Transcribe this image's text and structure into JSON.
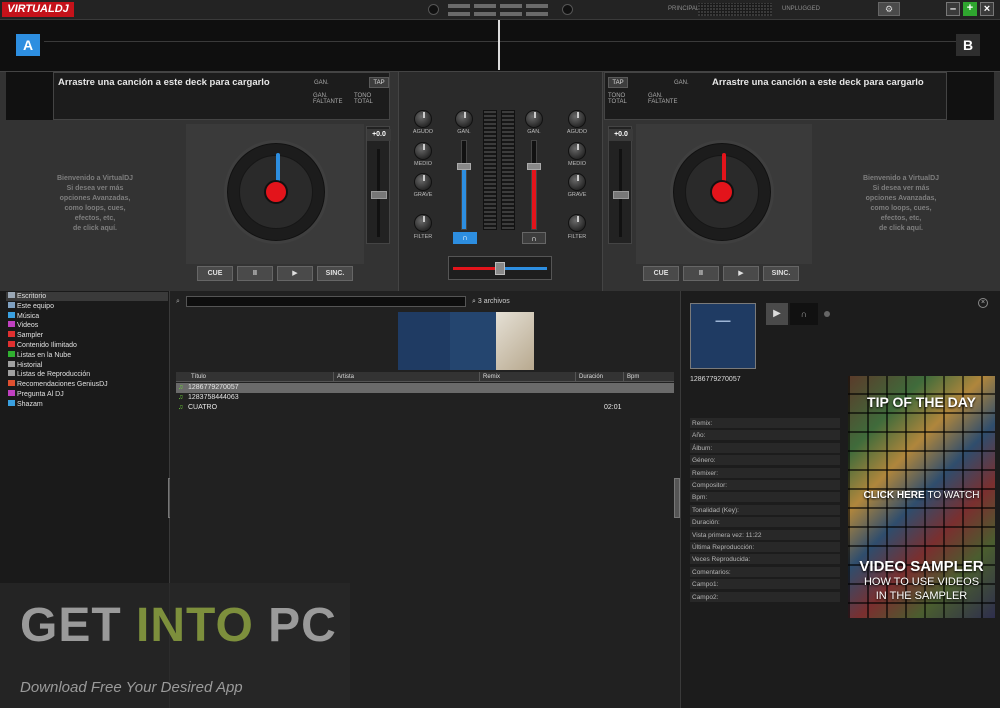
{
  "app": {
    "logo": "VIRTUALDJ"
  },
  "topbar": {
    "rec_label": "PRINCIPAL",
    "mic_label": "UNPLUGGED",
    "settings_icon": "gear-icon"
  },
  "decks": {
    "a": {
      "badge": "A",
      "load_text": "Arrastre una canción a este deck para cargarlo",
      "gain_label": "GAN.",
      "tap_label": "TAP",
      "remaining_label": "GAN. FALTANTE",
      "total_label": "TONO TOTAL",
      "welcome": [
        "Bienvenido a VirtualDJ",
        "Si desea ver más",
        "opciones Avanzadas,",
        "como loops, cues,",
        "efectos, etc,",
        "de click aquí."
      ],
      "pitch": "+0.0",
      "transport": {
        "cue": "CUE",
        "pause": "II",
        "play": "▶",
        "sync": "SINC."
      },
      "accent": "#2d8ee0"
    },
    "b": {
      "badge": "B",
      "load_text": "Arrastre una canción a este deck para cargarlo",
      "gain_label": "GAN.",
      "tap_label": "TAP",
      "remaining_label": "TONO TOTAL",
      "total_label": "GAN. FALTANTE",
      "welcome": [
        "Bienvenido a VirtualDJ",
        "Si desea ver más",
        "opciones Avanzadas,",
        "como loops, cues,",
        "efectos, etc,",
        "de click aquí."
      ],
      "pitch": "+0.0",
      "transport": {
        "cue": "CUE",
        "pause": "II",
        "play": "▶",
        "sync": "SINC."
      },
      "accent": "#e3141b"
    }
  },
  "mixer": {
    "left_knobs": [
      "AGUDO",
      "MEDIO",
      "GRAVE",
      "FILTER"
    ],
    "right_knobs": [
      "AGUDO",
      "MEDIO",
      "GRAVE",
      "FILTER"
    ],
    "gain_left": "GAN.",
    "gain_right": "GAN.",
    "headphone_icon": "headphone-icon",
    "volume_left": 0.72,
    "volume_right": 0.72,
    "crossfader": 0.5
  },
  "browser": {
    "tree": [
      {
        "label": "Escritorio",
        "color": "#9aa7b5",
        "selected": true
      },
      {
        "label": "Este equipo",
        "color": "#7fa0c0"
      },
      {
        "label": "Música",
        "color": "#3aa0e0"
      },
      {
        "label": "Videos",
        "color": "#c040c0"
      },
      {
        "label": "Sampler",
        "color": "#e03030"
      },
      {
        "label": "Contenido Ilimitado",
        "color": "#e03030"
      },
      {
        "label": "Listas en la Nube",
        "color": "#30b030"
      },
      {
        "label": "Historial",
        "color": "#a0a0a0"
      },
      {
        "label": "Listas de Reproducción",
        "color": "#a0a0a0"
      },
      {
        "label": "Recomendaciones GeniusDJ",
        "color": "#e05030"
      },
      {
        "label": "Pregunta Al DJ",
        "color": "#c040c0"
      },
      {
        "label": "Shazam",
        "color": "#3aa0e0"
      }
    ],
    "file_count": "3 archivos",
    "columns": [
      "Título",
      "Artista",
      "Remix",
      "Duración",
      "Bpm"
    ],
    "rows": [
      {
        "title": "1286779270057",
        "duration": "",
        "selected": true
      },
      {
        "title": "1283758444063",
        "duration": ""
      },
      {
        "title": "CUATRO",
        "duration": "02:01"
      }
    ]
  },
  "info": {
    "id": "1286779270057",
    "fields": [
      "Remix:",
      "Año:",
      "Álbum:",
      "Género:",
      "Remixer:",
      "Compositor:",
      "Bpm:",
      "Tonalidad (Key):",
      "Duración:",
      "Vista primera vez: 11:22",
      "Última Reproducción:",
      "Veces Reproducida:",
      "Comentarios:",
      "Campo1:",
      "Campo2:"
    ],
    "ad": {
      "line1": "TIP OF THE DAY",
      "line2_a": "CLICK HERE",
      "line2_b": "TO WATCH",
      "line3": "VIDEO SAMPLER",
      "line4": "HOW TO USE VIDEOS",
      "line5": "IN THE SAMPLER"
    }
  },
  "watermark": {
    "title_a": "GET ",
    "title_b": "INTO",
    "title_c": " PC",
    "subtitle": "Download Free Your Desired App"
  }
}
